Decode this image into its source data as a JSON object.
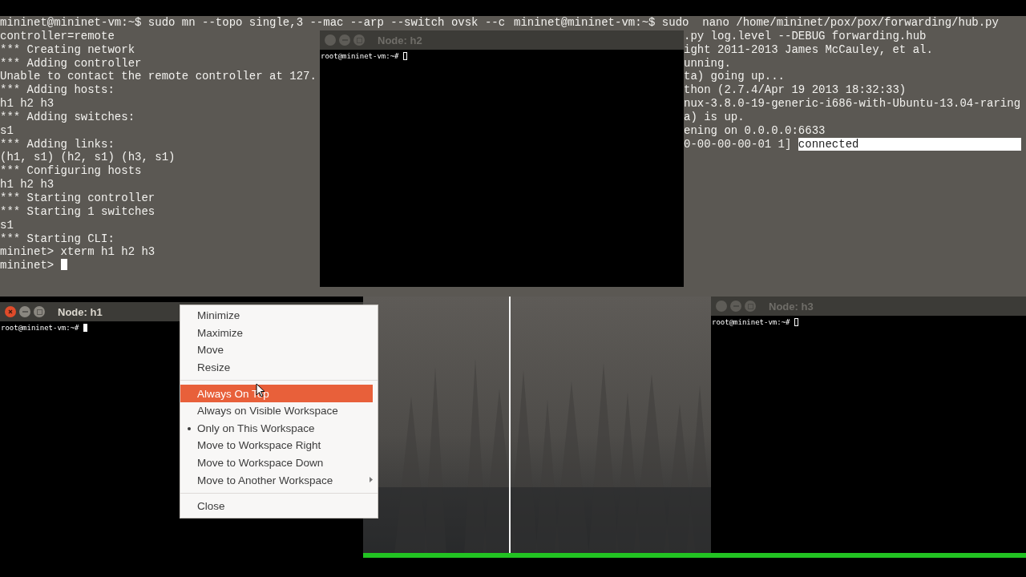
{
  "terminals": [
    {
      "cursor": true,
      "lines": [
        {
          "text": "mininet@mininet-vm:~$ sudo mn --topo single,3 --mac --arp --switch ovsk --c"
        },
        {
          "text": "controller=remote"
        },
        {
          "text": "*** Creating network"
        },
        {
          "text": "*** Adding controller"
        },
        {
          "text": "Unable to contact the remote controller at 127."
        },
        {
          "text": "*** Adding hosts:"
        },
        {
          "text": "h1 h2 h3"
        },
        {
          "text": "*** Adding switches:"
        },
        {
          "text": "s1"
        },
        {
          "text": "*** Adding links:"
        },
        {
          "text": "(h1, s1) (h2, s1) (h3, s1)"
        },
        {
          "text": "*** Configuring hosts"
        },
        {
          "text": "h1 h2 h3"
        },
        {
          "text": "*** Starting controller"
        },
        {
          "text": "*** Starting 1 switches"
        },
        {
          "text": "s1"
        },
        {
          "text": "*** Starting CLI:"
        },
        {
          "text": "mininet> xterm h1 h2 h3"
        },
        {
          "text": "mininet> "
        }
      ]
    },
    {
      "cursor": false,
      "lines": [
        {
          "text": "mininet@mininet-vm:~$ sudo  nano /home/mininet/pox/pox/forwarding/hub.py"
        },
        {
          "text": ".py log.level --DEBUG forwarding.hub"
        },
        {
          "text": "ight 2011-2013 James McCauley, et al."
        },
        {
          "text": "unning."
        },
        {
          "text": "ta) going up..."
        },
        {
          "text": "thon (2.7.4/Apr 19 2013 18:32:33)"
        },
        {
          "text": "nux-3.8.0-19-generic-i686-with-Ubuntu-13.04-raring"
        },
        {
          "text": "a) is up."
        },
        {
          "text": "ening on 0.0.0.0:6633"
        },
        {
          "text": "0-00-00-00-01 1] ",
          "selected_text": "connected"
        }
      ]
    }
  ],
  "windows": [
    {
      "title": "Node: h2",
      "prompt": "root@mininet-vm:~# ",
      "focused": false
    },
    {
      "title": "Node: h3",
      "prompt": "root@mininet-vm:~# ",
      "focused": false
    },
    {
      "title": "Node: h1",
      "prompt": "root@mininet-vm:~# ",
      "focused": true
    }
  ],
  "context_menu": {
    "sections": [
      {
        "items": [
          {
            "label": "Minimize",
            "kind": "action",
            "selected": false,
            "checked": false
          },
          {
            "label": "Maximize",
            "kind": "action",
            "selected": false,
            "checked": false
          },
          {
            "label": "Move",
            "kind": "action",
            "selected": false,
            "checked": false
          },
          {
            "label": "Resize",
            "kind": "action",
            "selected": false,
            "checked": false
          }
        ]
      },
      {
        "items": [
          {
            "label": "Always On Top",
            "kind": "action",
            "selected": true,
            "checked": false
          },
          {
            "label": "Always on Visible Workspace",
            "kind": "action",
            "selected": false,
            "checked": false
          },
          {
            "label": "Only on This Workspace",
            "kind": "action",
            "selected": false,
            "checked": true
          },
          {
            "label": "Move to Workspace Right",
            "kind": "action",
            "selected": false,
            "checked": false
          },
          {
            "label": "Move to Workspace Down",
            "kind": "action",
            "selected": false,
            "checked": false
          },
          {
            "label": "Move to Another Workspace",
            "kind": "submenu",
            "selected": false,
            "checked": false
          }
        ]
      },
      {
        "items": [
          {
            "label": "Close",
            "kind": "action",
            "selected": false,
            "checked": false
          }
        ]
      }
    ]
  }
}
